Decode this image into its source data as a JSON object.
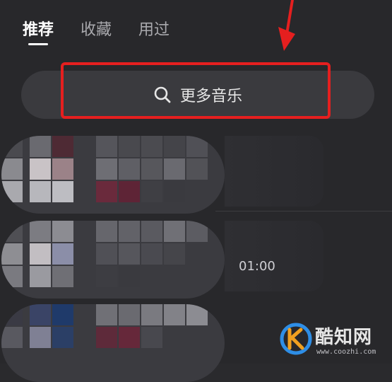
{
  "tabs": [
    {
      "label": "推荐",
      "active": true
    },
    {
      "label": "收藏",
      "active": false
    },
    {
      "label": "用过",
      "active": false
    }
  ],
  "search": {
    "label": "更多音乐",
    "icon": "search-icon"
  },
  "list": {
    "rows": [
      {
        "duration": ""
      },
      {
        "duration": "01:00"
      },
      {
        "duration": ""
      }
    ]
  },
  "annotation": {
    "arrow_color": "#e51f1f",
    "highlight_color": "#e51f1f"
  },
  "watermark": {
    "name": "酷知网",
    "url": "www.coozhi.com",
    "logo_icon": "k-logo-icon"
  }
}
